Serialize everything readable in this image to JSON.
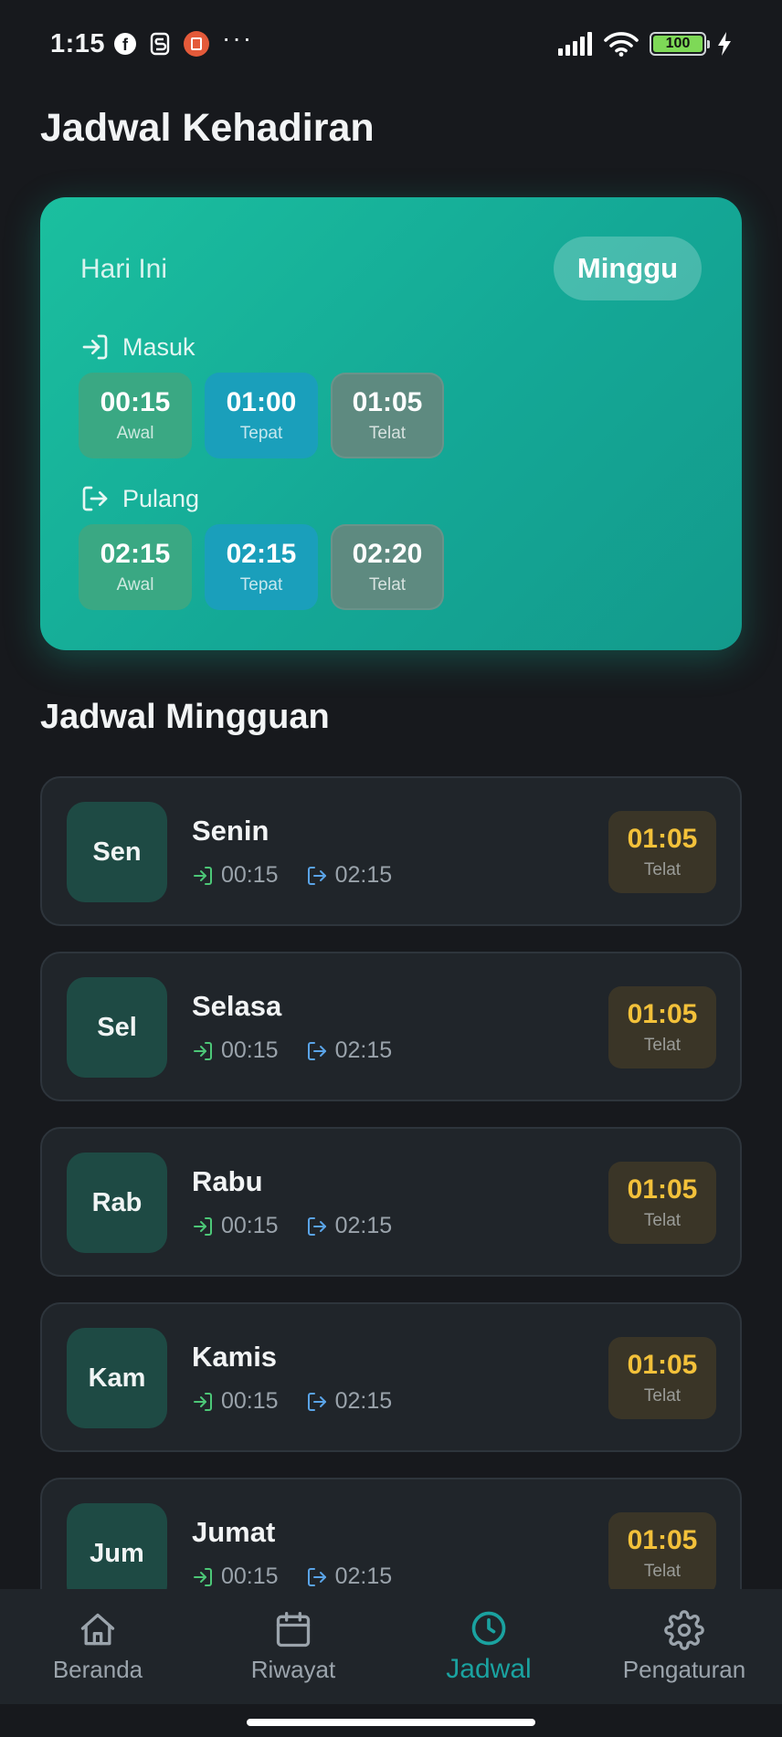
{
  "status_bar": {
    "time": "1:15",
    "dots": "···",
    "battery": "100"
  },
  "page": {
    "title": "Jadwal Kehadiran"
  },
  "today": {
    "label": "Hari Ini",
    "day": "Minggu",
    "masuk": {
      "label": "Masuk",
      "awal": {
        "time": "00:15",
        "label": "Awal"
      },
      "tepat": {
        "time": "01:00",
        "label": "Tepat"
      },
      "telat": {
        "time": "01:05",
        "label": "Telat"
      }
    },
    "pulang": {
      "label": "Pulang",
      "awal": {
        "time": "02:15",
        "label": "Awal"
      },
      "tepat": {
        "time": "02:15",
        "label": "Tepat"
      },
      "telat": {
        "time": "02:20",
        "label": "Telat"
      }
    }
  },
  "weekly": {
    "title": "Jadwal Mingguan",
    "days": [
      {
        "short": "Sen",
        "name": "Senin",
        "in": "00:15",
        "out": "02:15",
        "late": "01:05",
        "late_label": "Telat"
      },
      {
        "short": "Sel",
        "name": "Selasa",
        "in": "00:15",
        "out": "02:15",
        "late": "01:05",
        "late_label": "Telat"
      },
      {
        "short": "Rab",
        "name": "Rabu",
        "in": "00:15",
        "out": "02:15",
        "late": "01:05",
        "late_label": "Telat"
      },
      {
        "short": "Kam",
        "name": "Kamis",
        "in": "00:15",
        "out": "02:15",
        "late": "01:05",
        "late_label": "Telat"
      },
      {
        "short": "Jum",
        "name": "Jumat",
        "in": "00:15",
        "out": "02:15",
        "late": "01:05",
        "late_label": "Telat"
      }
    ]
  },
  "nav": {
    "items": [
      {
        "label": "Beranda",
        "icon": "home-icon"
      },
      {
        "label": "Riwayat",
        "icon": "calendar-icon"
      },
      {
        "label": "Jadwal",
        "icon": "clock-icon"
      },
      {
        "label": "Pengaturan",
        "icon": "gear-icon"
      }
    ],
    "active": "Jadwal"
  },
  "colors": {
    "background": "#17191d",
    "card_teal": "#14a896",
    "accent": "#1aa2a0",
    "late": "#f3c13a",
    "in_icon": "#4cc777",
    "out_icon": "#5aa4e8"
  }
}
